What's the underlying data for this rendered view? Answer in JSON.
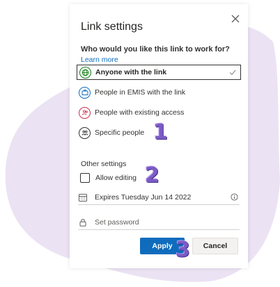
{
  "dialog": {
    "title": "Link settings",
    "question": "Who would you like this link to work for?",
    "learn_more": "Learn more",
    "options": [
      {
        "label": "Anyone with the link",
        "icon": "globe-icon",
        "color": "#107c10",
        "selected": true
      },
      {
        "label": "People in EMIS with the link",
        "icon": "briefcase-icon",
        "color": "#0f6cbd",
        "selected": false
      },
      {
        "label": "People with existing access",
        "icon": "people-icon",
        "color": "#c4314b",
        "selected": false
      },
      {
        "label": "Specific people",
        "icon": "group-icon",
        "color": "#323130",
        "selected": false
      }
    ],
    "other_settings_label": "Other settings",
    "allow_editing": {
      "label": "Allow editing",
      "checked": false
    },
    "expiry": {
      "text": "Expires Tuesday Jun 14 2022",
      "icon": "calendar-icon"
    },
    "password": {
      "placeholder": "Set password",
      "value": "",
      "icon": "lock-icon"
    },
    "buttons": {
      "apply": "Apply",
      "cancel": "Cancel"
    }
  },
  "annotations": [
    "1",
    "2",
    "3"
  ],
  "colors": {
    "accent": "#0f6cbd",
    "background_blob": "#ebe2f3",
    "annotation": "#7b5cc4"
  }
}
